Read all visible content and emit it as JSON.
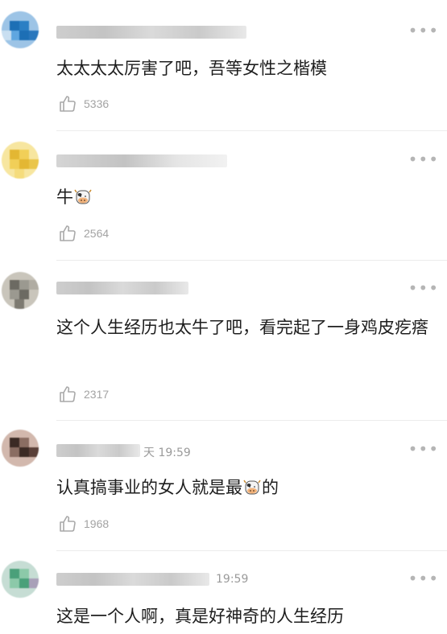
{
  "comments": [
    {
      "text": "太太太太厉害了吧，吾等女性之楷模",
      "likes": "5336",
      "time": "",
      "avatar_colors": [
        "#1d6fb5",
        "#5fa6e0",
        "#c9dff1"
      ]
    },
    {
      "text_before": "牛",
      "text_after": "",
      "likes": "2564",
      "time": "",
      "avatar_colors": [
        "#e3b733",
        "#f1cf58",
        "#f7e6a0"
      ]
    },
    {
      "text": "这个人生经历也太牛了吧，看完起了一身鸡皮疙瘩",
      "likes": "2317",
      "time": "",
      "avatar_colors": [
        "#6c6a62",
        "#9b9990",
        "#c9c5bb"
      ]
    },
    {
      "text_before": "认真搞事业的女人就是最",
      "text_after": "的",
      "likes": "1968",
      "time": "天 19:59",
      "avatar_colors": [
        "#3b2a24",
        "#8a6d62",
        "#d2b8ad"
      ]
    },
    {
      "text": "这是一个人啊，真是好神奇的人生经历",
      "likes": "",
      "time": "19:59",
      "avatar_colors": [
        "#4aa07a",
        "#8cc9a9",
        "#c6ddd4"
      ]
    }
  ],
  "icons": {
    "like": "thumbs-up-icon",
    "more": "more-dots-icon",
    "emoji": "cow-emoji-icon"
  },
  "more_glyph": "•••"
}
